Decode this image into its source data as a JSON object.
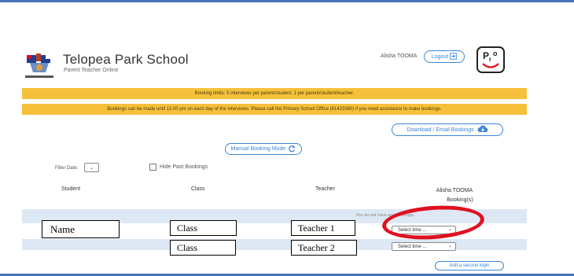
{
  "header": {
    "school_name": "Telopea Park School",
    "subtitle": "Parent Teacher Online",
    "user_name": "Alisha TOOMA",
    "logout_label": "Logout",
    "logo_text": "P",
    "logo_sub": "t",
    "logo_sup": "o"
  },
  "banners": {
    "limits": "Booking limits: 5 interviews per parent/student, 1 per parent/student/teacher.",
    "deadline": "Bookings can be made until 12.00 pm on each day of the interviews. Please call the Primary School Office (61423380) if you need assistance to make bookings."
  },
  "buttons": {
    "download": "Download / Email Bookings",
    "manual_mode": "Manual Booking Mode",
    "second_login": "Add a second login"
  },
  "filters": {
    "filter_date_label": "Filter Date:",
    "hide_past_label": "Hide Past Bookings"
  },
  "table": {
    "headers": {
      "student": "Student",
      "class": "Class",
      "teacher": "Teacher",
      "bookings_name": "Alisha TOOMA",
      "bookings_label": "Booking(s)"
    },
    "no_bookings": "You do not have any bookings.",
    "rows": [
      {
        "student": "Name",
        "class": "Class",
        "teacher": "Teacher 1",
        "time": "Select time ..."
      },
      {
        "student": "",
        "class": "Class",
        "teacher": "Teacher 2",
        "time": "Select time ..."
      }
    ]
  },
  "colors": {
    "accent": "#3a86d8",
    "banner": "#f6c03a",
    "highlight": "#e01020",
    "rule": "#4a72b8"
  }
}
